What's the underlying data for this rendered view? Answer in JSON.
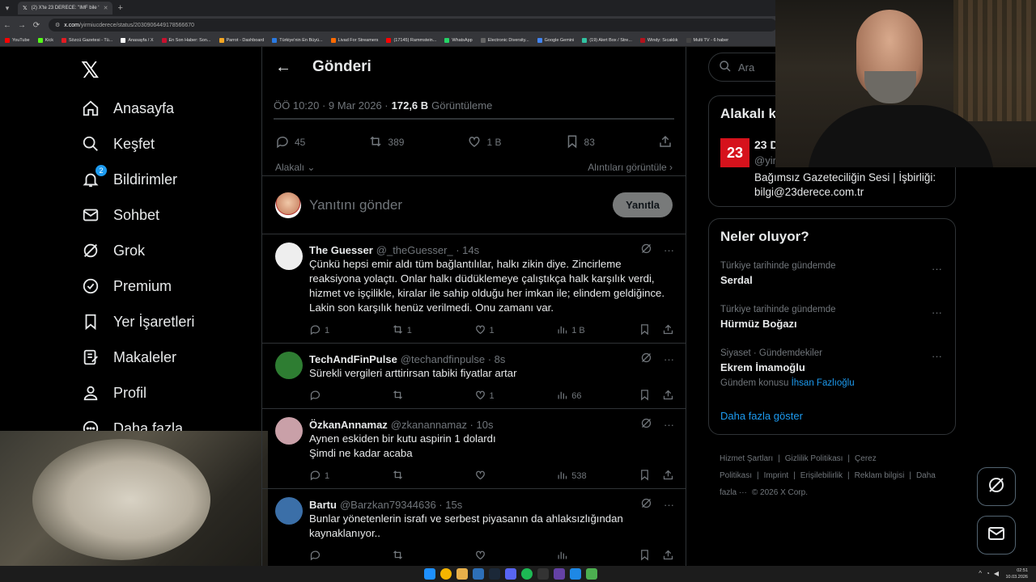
{
  "browser": {
    "tabs": [
      {
        "label": "(2) X'te 23 DERECE: \"IMF bile ‘",
        "active": true
      }
    ],
    "url_host": "x.com",
    "url_path": "/yirmiucderece/status/2030906449178566670",
    "bookmarks": [
      {
        "label": "YouTube",
        "color": "#ff0000"
      },
      {
        "label": "Kick",
        "color": "#53fc18"
      },
      {
        "label": "Sözcü Gazetesi - Tü...",
        "color": "#e21b22"
      },
      {
        "label": "Anasayfa / X",
        "color": "#ffffff"
      },
      {
        "label": "En Son Haber: Son...",
        "color": "#c8102e"
      },
      {
        "label": "Parrot - Dashboard",
        "color": "#f5a623"
      },
      {
        "label": "Türkiye'nin En Büyü...",
        "color": "#2a7ae2"
      },
      {
        "label": "Livad For Streamers",
        "color": "#ff6a00"
      },
      {
        "label": "(17145) Rammstein...",
        "color": "#ff0000"
      },
      {
        "label": "WhatsApp",
        "color": "#25d366"
      },
      {
        "label": "Electronic Diversity...",
        "color": "#666666"
      },
      {
        "label": "Google Gemini",
        "color": "#4285f4"
      },
      {
        "label": "(19) Alert Box / Stre...",
        "color": "#31c3a2"
      },
      {
        "label": "Windy: Sıcaklık",
        "color": "#b3121c"
      },
      {
        "label": "Multi TV - 6 haber",
        "color": "#444444"
      }
    ]
  },
  "sidebar": {
    "items": [
      {
        "label": "Anasayfa",
        "icon": "home-icon"
      },
      {
        "label": "Keşfet",
        "icon": "search-icon"
      },
      {
        "label": "Bildirimler",
        "icon": "bell-icon",
        "badge": "2"
      },
      {
        "label": "Sohbet",
        "icon": "mail-icon"
      },
      {
        "label": "Grok",
        "icon": "grok-icon"
      },
      {
        "label": "Premium",
        "icon": "verified-icon"
      },
      {
        "label": "Yer İşaretleri",
        "icon": "bookmark-icon"
      },
      {
        "label": "Makaleler",
        "icon": "article-icon"
      },
      {
        "label": "Profil",
        "icon": "person-icon"
      },
      {
        "label": "Daha fazla",
        "icon": "more-icon"
      }
    ]
  },
  "post": {
    "header_title": "Gönderi",
    "time": "ÖÖ 10:20 · 9 Mar 2026 ·",
    "views": "172,6 B",
    "views_label": "Görüntüleme",
    "replies": "45",
    "reposts": "389",
    "likes": "1 B",
    "bookmarks": "83",
    "sort_label": "Alakalı",
    "quotes_label": "Alıntıları görüntüle",
    "reply_placeholder": "Yanıtını gönder",
    "reply_button": "Yanıtla"
  },
  "replies": [
    {
      "name": "The Guesser",
      "handle": "@_theGuesser_ · 14s",
      "text": "Çünkü hepsi emir aldı tüm bağlantılılar, halkı zikin diye. Zincirleme reaksiyona yolaçtı. Onlar halkı düdüklemeye çalıştıkça halk karşılık verdi, hizmet ve işçilikle, kiralar ile sahip olduğu her imkan ile; elindem geldiğince. Lakin son karşılık henüz verilmedi. Onu zamanı var.",
      "replies": "1",
      "reposts": "1",
      "likes": "1",
      "views": "1 B",
      "avatar_color": "#eeeeee"
    },
    {
      "name": "TechAndFinPulse",
      "handle": "@techandfinpulse · 8s",
      "text": "Sürekli vergileri arttirirsan tabiki fiyatlar artar",
      "replies": "",
      "reposts": "",
      "likes": "1",
      "views": "66",
      "avatar_color": "#2e7d32"
    },
    {
      "name": "ÖzkanAnnamaz",
      "handle": "@zkanannamaz · 10s",
      "text": "Aynen eskiden bir kutu aspirin 1 dolardı\nŞimdi ne kadar acaba",
      "replies": "1",
      "reposts": "",
      "likes": "",
      "views": "538",
      "avatar_color": "#c9a0a8"
    },
    {
      "name": "Bartu",
      "handle": "@Barzkan79344636 · 15s",
      "text": "Bunlar yönetenlerin israfı ve serbest piyasanın da ahlaksızlığından kaynaklanıyor..",
      "replies": "",
      "reposts": "",
      "likes": "",
      "views": "",
      "avatar_color": "#3b6fa8"
    }
  ],
  "right": {
    "search_placeholder": "Ara",
    "related_title": "Alakalı k",
    "related_logo": "23",
    "related_name": "23 D",
    "related_handle": "@yir",
    "related_bio": "Bağımsız Gazeteciliğin Sesi | İşbirliği: bilgi@23derece.com.tr",
    "trends_title": "Neler oluyor?",
    "trends": [
      {
        "context": "Türkiye tarihinde gündemde",
        "name": "Serdal",
        "topic_label": "",
        "topic": ""
      },
      {
        "context": "Türkiye tarihinde gündemde",
        "name": "Hürmüz Boğazı",
        "topic_label": "",
        "topic": ""
      },
      {
        "context": "Siyaset · Gündemdekiler",
        "name": "Ekrem İmamoğlu",
        "topic_label": "Gündem konusu",
        "topic": "İhsan Fazlıoğlu"
      }
    ],
    "show_more": "Daha fazla göster",
    "footer": [
      "Hizmet Şartları",
      "|",
      "Gizlilik Politikası",
      "|",
      "Çerez Politikası",
      "|",
      "Imprint",
      "|",
      "Erişilebilirlik",
      "|",
      "Reklam bilgisi",
      "|",
      "Daha fazla ···",
      "© 2026 X Corp."
    ]
  },
  "taskbar": {
    "time": "02:51",
    "date": "10.03.2026"
  },
  "colors": {
    "accent": "#1d9bf0",
    "border": "#2f3336",
    "muted": "#71767b"
  }
}
